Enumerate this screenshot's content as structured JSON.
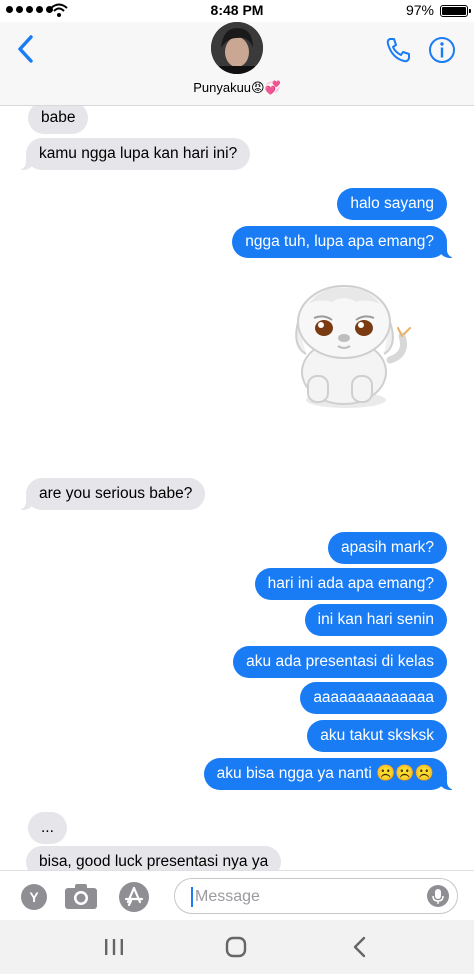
{
  "status_bar": {
    "time": "8:48 PM",
    "battery": "97%",
    "battery_level": 0.97
  },
  "header": {
    "contact_name": "Punyakuu😡💞",
    "icons": [
      "back-chevron-icon",
      "phone-icon",
      "info-icon"
    ]
  },
  "messages": [
    {
      "dir": "in",
      "text": "babe"
    },
    {
      "dir": "in",
      "text": "kamu ngga lupa kan hari ini?"
    },
    {
      "dir": "out",
      "text": "halo sayang"
    },
    {
      "dir": "out",
      "text": "ngga tuh, lupa apa emang?"
    },
    {
      "dir": "out",
      "sticker": "puppy-sticker"
    },
    {
      "dir": "in",
      "text": "are you serious babe?"
    },
    {
      "dir": "out",
      "text": "apasih mark?"
    },
    {
      "dir": "out",
      "text": "hari ini ada apa emang?"
    },
    {
      "dir": "out",
      "text": "ini kan hari senin"
    },
    {
      "dir": "out",
      "text": "aku ada presentasi di kelas"
    },
    {
      "dir": "out",
      "text": "aaaaaaaaaaaaaa"
    },
    {
      "dir": "out",
      "text": "aku takut sksksk"
    },
    {
      "dir": "out",
      "text": "aku bisa ngga ya nanti ☹️☹️☹️"
    },
    {
      "dir": "in",
      "text": "..."
    },
    {
      "dir": "in",
      "text": "bisa, good luck presentasi nya ya"
    }
  ],
  "input_bar": {
    "placeholder": "Message",
    "icons": [
      "yahoo-app-icon",
      "camera-icon",
      "app-store-icon",
      "microphone-icon"
    ]
  },
  "nav_bar": {
    "icons": [
      "recents-icon",
      "home-icon",
      "back-icon"
    ]
  },
  "colors": {
    "outgoing": "#1a7cf5",
    "incoming": "#e5e5ea",
    "accent": "#1a7cf5"
  }
}
